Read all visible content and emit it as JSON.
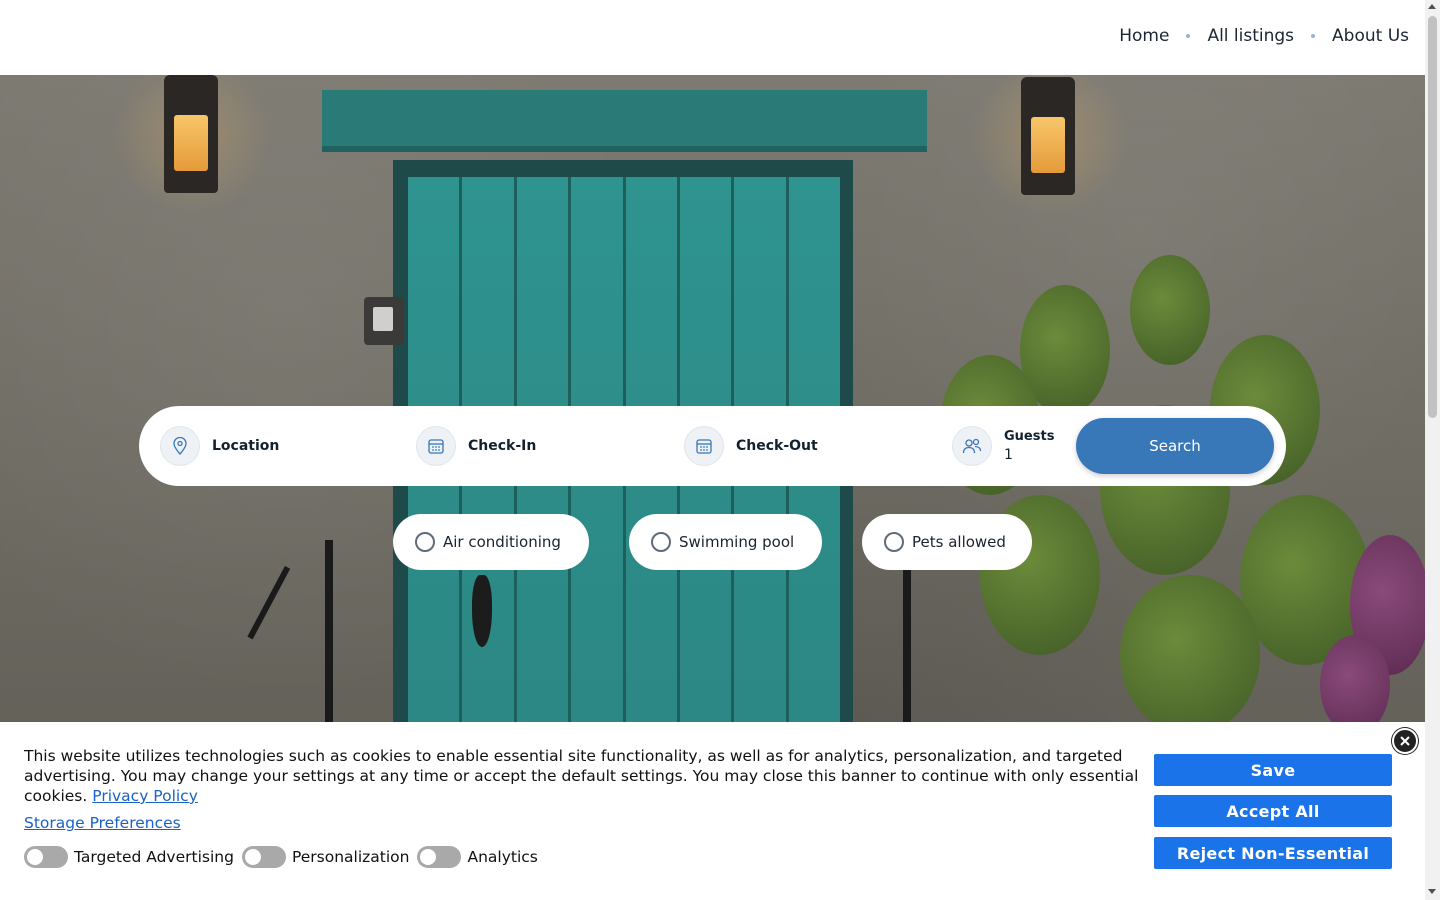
{
  "nav": {
    "items": [
      "Home",
      "All listings",
      "About Us"
    ]
  },
  "search": {
    "location_label": "Location",
    "checkin_label": "Check-In",
    "checkout_label": "Check-Out",
    "guests_label": "Guests",
    "guests_value": "1",
    "search_button": "Search",
    "icons": [
      "map-pin-icon",
      "calendar-icon",
      "calendar-icon",
      "users-icon"
    ]
  },
  "amenities": [
    "Air conditioning",
    "Swimming pool",
    "Pets allowed"
  ],
  "cookie": {
    "text": "This website utilizes technologies such as cookies to enable essential site functionality, as well as for analytics, personalization, and targeted advertising. You may change your settings at any time or accept the default settings. You may close this banner to continue with only essential cookies.",
    "privacy_link": "Privacy Policy",
    "storage_link": "Storage Preferences",
    "toggles": [
      "Targeted Advertising",
      "Personalization",
      "Analytics"
    ],
    "buttons": {
      "save": "Save",
      "accept": "Accept All",
      "reject": "Reject Non-Essential"
    }
  },
  "colors": {
    "accent": "#3878b8",
    "cookie_button": "#1a73e8",
    "link": "#1a62c9",
    "door": "#2b8a87"
  }
}
